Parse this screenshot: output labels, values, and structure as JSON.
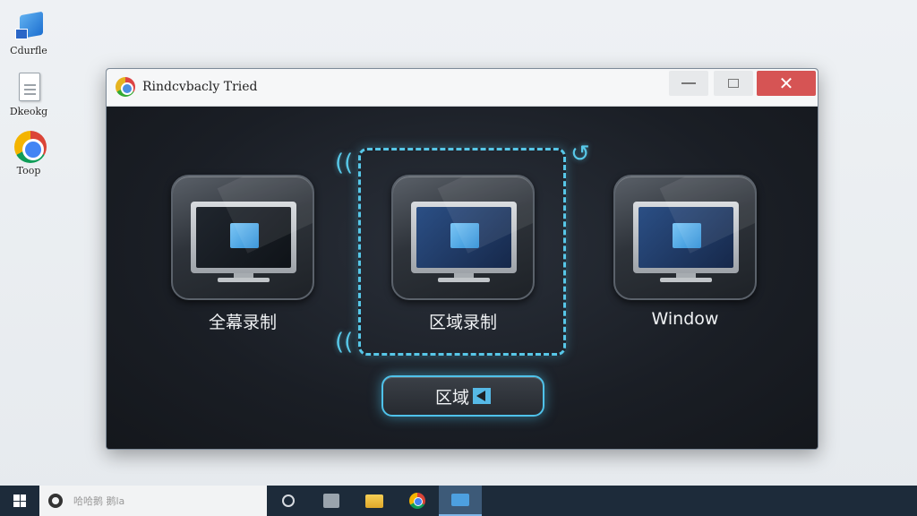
{
  "desktop": {
    "icons": [
      {
        "label": "Cdurfle"
      },
      {
        "label": "Dkeokg"
      },
      {
        "label": "Toop"
      }
    ]
  },
  "window": {
    "title": "Rindcvbacly Tried",
    "close_symbol": "✕",
    "options": [
      {
        "label": "全幕录制",
        "icon": "monitor-icon"
      },
      {
        "label": "区域录制",
        "icon": "monitor-icon"
      },
      {
        "label": "Window",
        "icon": "monitor-icon"
      }
    ],
    "action_button": {
      "label": "区域"
    }
  },
  "taskbar": {
    "search_placeholder": "哈哈鹅 鹅la",
    "apps": [
      "cortana-icon",
      "tv-icon",
      "folder-icon",
      "chrome-icon",
      "mail-icon"
    ]
  },
  "colors": {
    "accent": "#57c7e8",
    "close": "#d65454",
    "taskbar": "#1d2b3a"
  }
}
